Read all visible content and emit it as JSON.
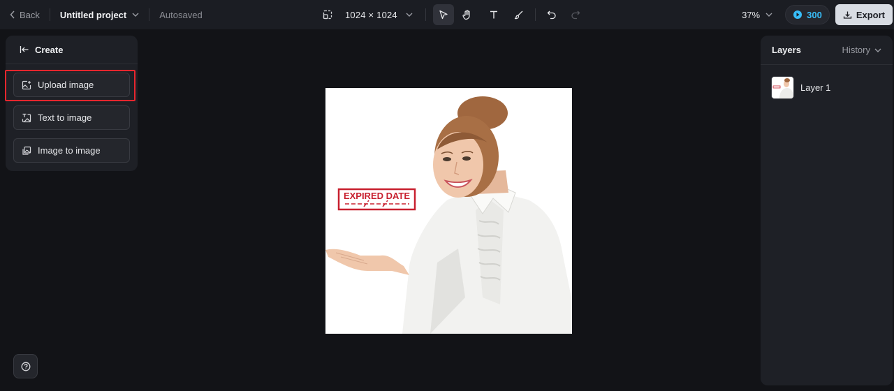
{
  "topbar": {
    "back_label": "Back",
    "project_title": "Untitled project",
    "autosave_status": "Autosaved",
    "canvas_size": "1024 × 1024",
    "tools": [
      "select-icon",
      "hand-icon",
      "text-icon",
      "brush-icon",
      "undo-icon",
      "redo-icon"
    ],
    "zoom": "37%",
    "credits": "300",
    "export_label": "Export"
  },
  "left_panel": {
    "header": "Create",
    "items": [
      {
        "label": "Upload image",
        "icon": "upload-image-icon",
        "highlighted": true
      },
      {
        "label": "Text to image",
        "icon": "text-to-image-icon"
      },
      {
        "label": "Image to image",
        "icon": "image-to-image-icon"
      }
    ]
  },
  "canvas": {
    "stamp_text": "EXPIRED DATE"
  },
  "right_panel": {
    "title": "Layers",
    "history_label": "History",
    "layers": [
      {
        "name": "Layer 1"
      }
    ]
  },
  "colors": {
    "background": "#121317",
    "panel": "#1e2026",
    "credits_accent": "#38bdf8",
    "highlight": "#e8262e",
    "stamp": "#c8202f"
  }
}
